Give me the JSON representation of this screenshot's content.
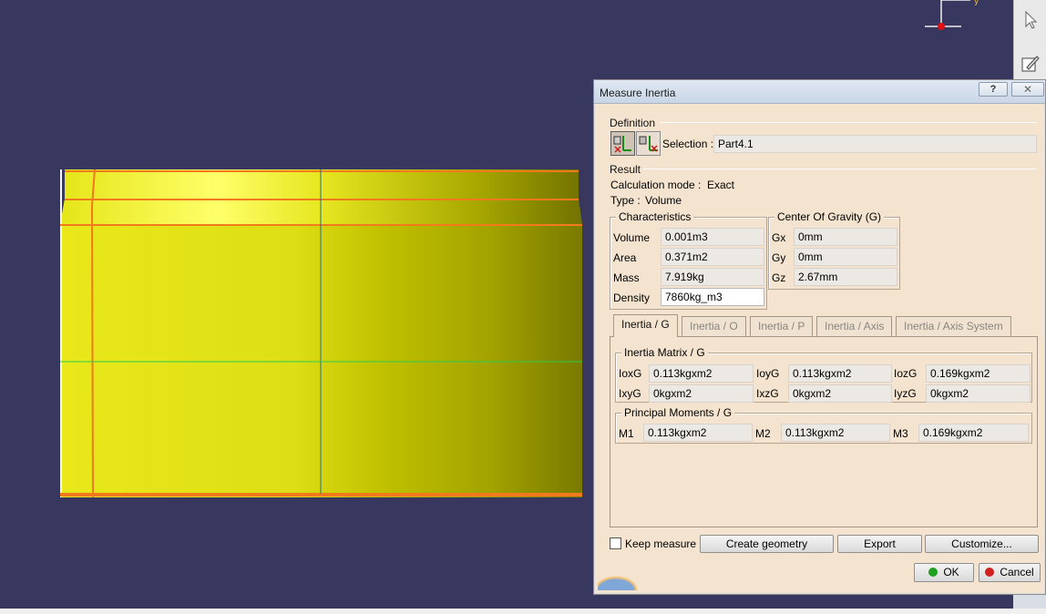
{
  "dialog": {
    "title": "Measure Inertia",
    "help_label": "?",
    "definition": {
      "label": "Definition",
      "selection_label": "Selection :",
      "selection_value": "Part4.1"
    },
    "result": {
      "label": "Result",
      "calc_mode_label": "Calculation mode :",
      "calc_mode_value": "Exact",
      "type_label": "Type :",
      "type_value": "Volume"
    },
    "characteristics": {
      "title": "Characteristics",
      "rows": [
        {
          "label": "Volume",
          "value": "0.001m3"
        },
        {
          "label": "Area",
          "value": "0.371m2"
        },
        {
          "label": "Mass",
          "value": "7.919kg"
        },
        {
          "label": "Density",
          "value": "7860kg_m3"
        }
      ]
    },
    "center_of_gravity": {
      "title": "Center Of Gravity (G)",
      "rows": [
        {
          "label": "Gx",
          "value": "0mm"
        },
        {
          "label": "Gy",
          "value": "0mm"
        },
        {
          "label": "Gz",
          "value": "2.67mm"
        }
      ]
    },
    "tabs": [
      {
        "label": "Inertia / G",
        "active": true
      },
      {
        "label": "Inertia / O",
        "active": false
      },
      {
        "label": "Inertia / P",
        "active": false
      },
      {
        "label": "Inertia / Axis",
        "active": false
      },
      {
        "label": "Inertia / Axis System",
        "active": false
      }
    ],
    "inertia_matrix": {
      "title": "Inertia Matrix / G",
      "cells": [
        {
          "label": "IoxG",
          "value": "0.113kgxm2"
        },
        {
          "label": "IoyG",
          "value": "0.113kgxm2"
        },
        {
          "label": "IozG",
          "value": "0.169kgxm2"
        },
        {
          "label": "IxyG",
          "value": "0kgxm2"
        },
        {
          "label": "IxzG",
          "value": "0kgxm2"
        },
        {
          "label": "IyzG",
          "value": "0kgxm2"
        }
      ]
    },
    "principal_moments": {
      "title": "Principal Moments / G",
      "cells": [
        {
          "label": "M1",
          "value": "0.113kgxm2"
        },
        {
          "label": "M2",
          "value": "0.113kgxm2"
        },
        {
          "label": "M3",
          "value": "0.169kgxm2"
        }
      ]
    },
    "keep_measure_label": "Keep measure",
    "keep_measure_checked": false,
    "buttons": {
      "create_geometry": "Create geometry",
      "export": "Export",
      "customize": "Customize...",
      "ok": "OK",
      "cancel": "Cancel"
    }
  },
  "colors": {
    "viewport_bg": "#37375f",
    "part_yellow": "#e6e61a",
    "edge_orange": "#f07a1c",
    "dialog_bg": "#f4e4cf",
    "ok_green": "#1ea11e",
    "cancel_red": "#d11f1f"
  },
  "icons": {
    "compass": "compass-icon",
    "select": "select-arrow-icon",
    "sketch": "sketch-icon",
    "close": "close-icon"
  }
}
